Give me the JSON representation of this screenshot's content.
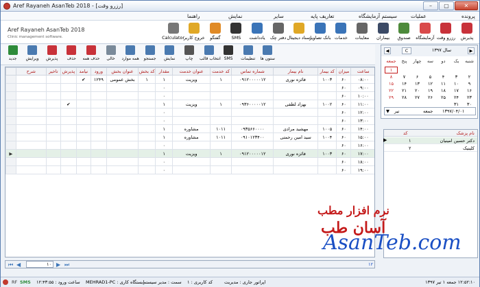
{
  "window": {
    "title": "Aref Rayaneh AsanTeb 2018 - [رزرو وقت]",
    "min": "–",
    "max": "▢",
    "close": "✕"
  },
  "menu": [
    "پرونده",
    "عملیات",
    "سیستم آزمایشگاه",
    "تعاریف پایه",
    "سایر",
    "نمایش",
    "راهنما"
  ],
  "brand": {
    "name": "Aref Rayaneh AsanTeb 2018",
    "sub": "Clinic management software."
  },
  "toolbar": [
    {
      "label": "پذیرش",
      "icon": "calendar-red-icon",
      "color": "#c8323a"
    },
    {
      "label": "رزرو وقت",
      "icon": "calendar-icon",
      "color": "#c8323a"
    },
    {
      "label": "آزمایشگاه",
      "icon": "flask-icon",
      "color": "#d94a4a"
    },
    {
      "label": "صندوق",
      "icon": "cash-box-icon",
      "color": "#4d8a3b"
    },
    {
      "label": "بیماران",
      "icon": "patient-icon",
      "color": "#3b4a66"
    },
    {
      "label": "معاینات",
      "icon": "stethoscope-icon",
      "color": "#666666"
    },
    {
      "label": "خدمات",
      "icon": "services-icon",
      "color": "#3a74b8"
    },
    {
      "label": "بانک تصاویر",
      "icon": "image-bank-icon",
      "color": "#3a74b8"
    },
    {
      "label": "اسناد دیجیتال",
      "icon": "folder-icon",
      "color": "#e0a826"
    },
    {
      "label": "دفتر چک",
      "icon": "checkbook-icon",
      "color": "#666666"
    },
    {
      "label": "یادداشت",
      "icon": "notebook-icon",
      "color": "#3a74b8"
    },
    {
      "label": "SMS",
      "icon": "sms-icon",
      "color": "#333333"
    },
    {
      "label": "گفتگو",
      "icon": "chat-icon",
      "color": "#e08a26"
    },
    {
      "label": "خروج کاربر",
      "icon": "logout-icon",
      "color": "#e0a826"
    },
    {
      "label": "Calculator",
      "icon": "calculator-icon",
      "color": "#777777"
    }
  ],
  "toolbar2": [
    {
      "label": "جدید",
      "icon": "add-icon",
      "color": "#2e8b3a"
    },
    {
      "label": "ویرایش",
      "icon": "edit-icon",
      "color": "#4a7ab0"
    },
    {
      "label": "پذیرش",
      "icon": "admit-icon",
      "color": "#c8323a"
    },
    {
      "label": "حذف",
      "icon": "delete-icon",
      "color": "#c8323a"
    },
    {
      "label": "حذف همه",
      "icon": "delete-all-icon",
      "color": "#c8323a"
    },
    {
      "label": "خالی",
      "icon": "blank-icon",
      "color": "#7a8a9a"
    },
    {
      "label": "همه موارد",
      "icon": "all-items-icon",
      "color": "#4a7ab0"
    },
    {
      "label": "جستجو",
      "icon": "search-icon",
      "color": "#4a7ab0"
    },
    {
      "label": "نمایش",
      "icon": "view-icon",
      "color": "#4a7ab0"
    },
    {
      "label": "چاپ",
      "icon": "print-icon",
      "color": "#555555"
    },
    {
      "label": "انتخاب قالب",
      "icon": "template-icon",
      "color": "#4a7ab0"
    },
    {
      "label": "SMS",
      "icon": "sms-icon",
      "color": "#333333"
    },
    {
      "label": "تنظیمات",
      "icon": "settings-icon",
      "color": "#4a7ab0"
    },
    {
      "label": "ستون ها",
      "icon": "columns-icon",
      "color": "#4a7ab0"
    }
  ],
  "grid": {
    "columns": [
      "ساعت",
      "میزان",
      "کد بیمار",
      "نام بیمار",
      "شماره تماس",
      "کد خدمت",
      "عنوان خدمت",
      "مقدار",
      "کد بخش",
      "عنوان بخش",
      "ورود",
      "نیامد",
      "پذیرش",
      "تاخیر",
      "شرح"
    ],
    "rows": [
      [
        "۰۸:۰۰",
        "۶۰",
        "۱۰۰۳",
        "فائزه نوری",
        "۰۹۱۲۰۰۰۰۰۱۲",
        "۱",
        "ویزیت",
        "۱",
        "۱",
        "بخش عمومی",
        "۱۲۴۹",
        "✔",
        "",
        "",
        ""
      ],
      [
        "۰۹:۰۰",
        "۶۰",
        "",
        "",
        "",
        "",
        "",
        "۰",
        "",
        "",
        "",
        "",
        "",
        "",
        ""
      ],
      [
        "۱۰:۰۰",
        "۶۰",
        "",
        "",
        "",
        "",
        "",
        "۰",
        "",
        "",
        "",
        "",
        "",
        "",
        ""
      ],
      [
        "۱۱:۰۰",
        "۶۰",
        "۱۰۰۲",
        "بهزاد لطفی",
        "۰۹۳۶۰۰۰۰۰۱۲",
        "۱",
        "ویزیت",
        "۱",
        "",
        "",
        "",
        "",
        "✔",
        "",
        ""
      ],
      [
        "۱۲:۰۰",
        "۶۰",
        "",
        "",
        "",
        "",
        "",
        "۰",
        "",
        "",
        "",
        "",
        "",
        "",
        ""
      ],
      [
        "۱۳:۰۰",
        "۶۰",
        "",
        "",
        "",
        "",
        "",
        "۰",
        "",
        "",
        "",
        "",
        "",
        "",
        ""
      ],
      [
        "۱۴:۰۰",
        "۶۰",
        "۱۰۰۵",
        "مهشید مرادی",
        "۰۹۳۵۶۶۰۰۰۰",
        "۱۰۱۱",
        "مشاوره",
        "۱",
        "",
        "",
        "",
        "",
        "",
        "",
        ""
      ],
      [
        "۱۵:۰۰",
        "۶۰",
        "۱۰۰۴",
        "سید امین رحمتی",
        "۰۹۱۰۱۲۳۴۰۰",
        "۱۰۱۱",
        "مشاوره",
        "۱",
        "",
        "",
        "",
        "",
        "",
        "",
        ""
      ],
      [
        "۱۶:۰۰",
        "۶۰",
        "",
        "",
        "",
        "",
        "",
        "۰",
        "",
        "",
        "",
        "",
        "",
        "",
        ""
      ],
      [
        "۱۷:۰۰",
        "۶۰",
        "۱۰۰۳",
        "فائزه نوری",
        "۰۹۱۲۰۰۰۰۰۱۲",
        "۱",
        "ویزیت",
        "۱",
        "",
        "",
        "",
        "",
        "",
        "",
        ""
      ],
      [
        "۱۸:۰۰",
        "۶۰",
        "",
        "",
        "",
        "",
        "",
        "۰",
        "",
        "",
        "",
        "",
        "",
        "",
        ""
      ],
      [
        "۱۹:۰۰",
        "۶۰",
        "",
        "",
        "",
        "",
        "",
        "۰",
        "",
        "",
        "",
        "",
        "",
        "",
        ""
      ]
    ],
    "selected_row": 9,
    "footer_count": "۱۲"
  },
  "calendar": {
    "year_label": "سال ۱۳۹۷",
    "month_label": "تیر",
    "weekdays": [
      "شنبه",
      "یک",
      "دو",
      "سه",
      "چهار",
      "پنج",
      "جمعه"
    ],
    "days": [
      "",
      "",
      "",
      "",
      "",
      "",
      "۱",
      "۲",
      "۳",
      "۴",
      "۵",
      "۶",
      "۷",
      "۸",
      "۹",
      "۱۰",
      "۱۱",
      "۱۲",
      "۱۳",
      "۱۴",
      "۱۵",
      "۱۶",
      "۱۷",
      "۱۸",
      "۱۹",
      "۲۰",
      "۲۱",
      "۲۲",
      "۲۳",
      "۲۴",
      "۲۵",
      "۲۶",
      "۲۷",
      "۲۸",
      "۲۹",
      "۳۰",
      "۳۱"
    ],
    "selected_date": "۱۳۹۷/۰۴/۰۱",
    "selected_weekday": "جمعه",
    "c_button": "C"
  },
  "doctors": {
    "headers": [
      "نام پزشک",
      "کد"
    ],
    "rows": [
      [
        "دکتر حسین امینیان",
        "۱"
      ],
      [
        "کلینیک",
        "۲"
      ]
    ]
  },
  "pager": {
    "page": "۱۰"
  },
  "status": {
    "operator": "اپراتور جاری : مدیریت",
    "user_code": "کد کاربری : ۱",
    "shift": "سمت : مدیر سیستم",
    "station": "ایستگاه کاری : MEHRAD1-PC",
    "login_time": "ساعت ورود : ۱۲:۴۳:۵۵",
    "date_time": "۱۲:۵۲:۱۰ جمعه ۱ تیر ۱۳۹۷",
    "rf": "RF",
    "sms": "SMS"
  },
  "watermark": {
    "line1": "نرم افزار مطب",
    "line2": "آسان طب",
    "line3": "AsanTeb.com"
  },
  "colors": {
    "header_text": "#b01818",
    "selected_row": "#e4f0e7",
    "watermark_red": "#c41a1a",
    "watermark_blue": "#1a4fc4"
  }
}
